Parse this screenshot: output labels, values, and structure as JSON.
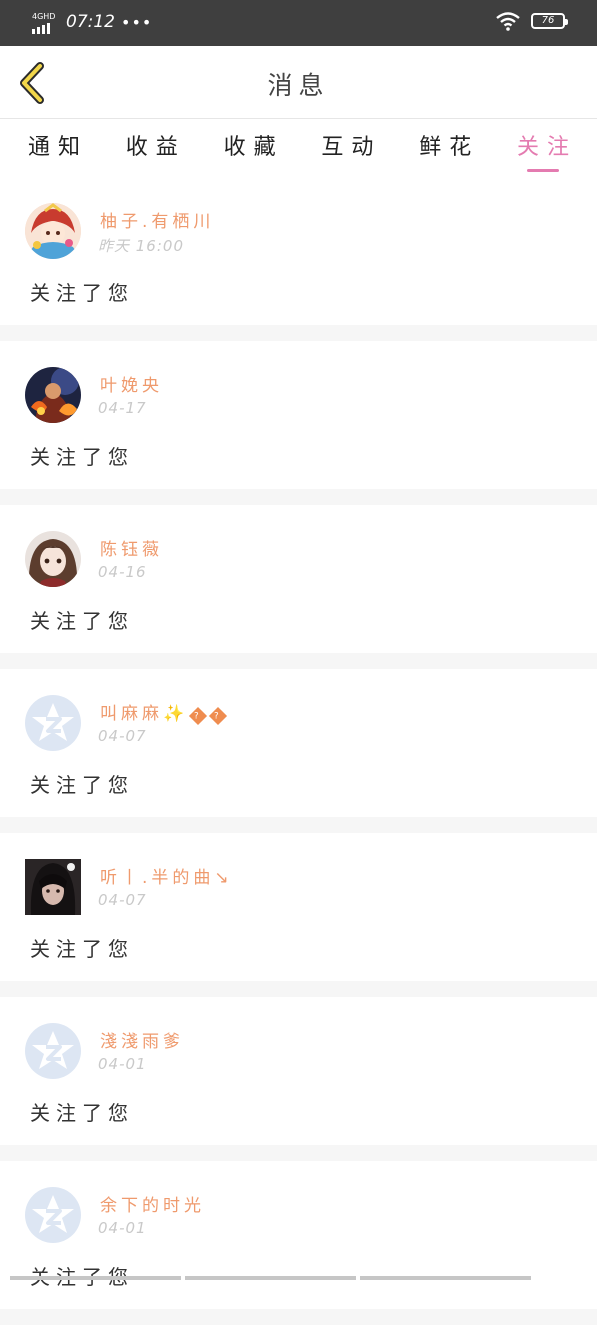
{
  "status_bar": {
    "network": "4GHD",
    "time": "07:12",
    "more_dots": "•••",
    "battery": "76"
  },
  "header": {
    "title": "消息"
  },
  "tabs": [
    {
      "label": "通知",
      "active": false
    },
    {
      "label": "收益",
      "active": false
    },
    {
      "label": "收藏",
      "active": false
    },
    {
      "label": "互动",
      "active": false
    },
    {
      "label": "鲜花",
      "active": false
    },
    {
      "label": "关注",
      "active": true
    }
  ],
  "notifications": [
    {
      "name": "柚子.有栖川",
      "time": "昨天 16:00",
      "message": "关注了您",
      "avatar": "anime-girl-red"
    },
    {
      "name": "叶娩央",
      "time": "04-17",
      "message": "关注了您",
      "avatar": "fire-warrior"
    },
    {
      "name": "陈钰薇",
      "time": "04-16",
      "message": "关注了您",
      "avatar": "anime-girl-brown-hair"
    },
    {
      "name": "叫麻麻✨",
      "name_suffix": "��",
      "time": "04-07",
      "message": "关注了您",
      "avatar": "default-qzone-star"
    },
    {
      "name": "听丨.半的曲↘",
      "time": "04-07",
      "message": "关注了您",
      "avatar": "photo-girl-dark"
    },
    {
      "name": "淺淺雨爹",
      "time": "04-01",
      "message": "关注了您",
      "avatar": "default-qzone-star"
    },
    {
      "name": "余下的时光",
      "time": "04-01",
      "message": "关注了您",
      "avatar": "default-qzone-star"
    }
  ],
  "colors": {
    "accent": "#e47bb0",
    "username": "#ef9a6d",
    "timestamp": "#c9c9c9",
    "back_arrow": "#f2d74a"
  }
}
